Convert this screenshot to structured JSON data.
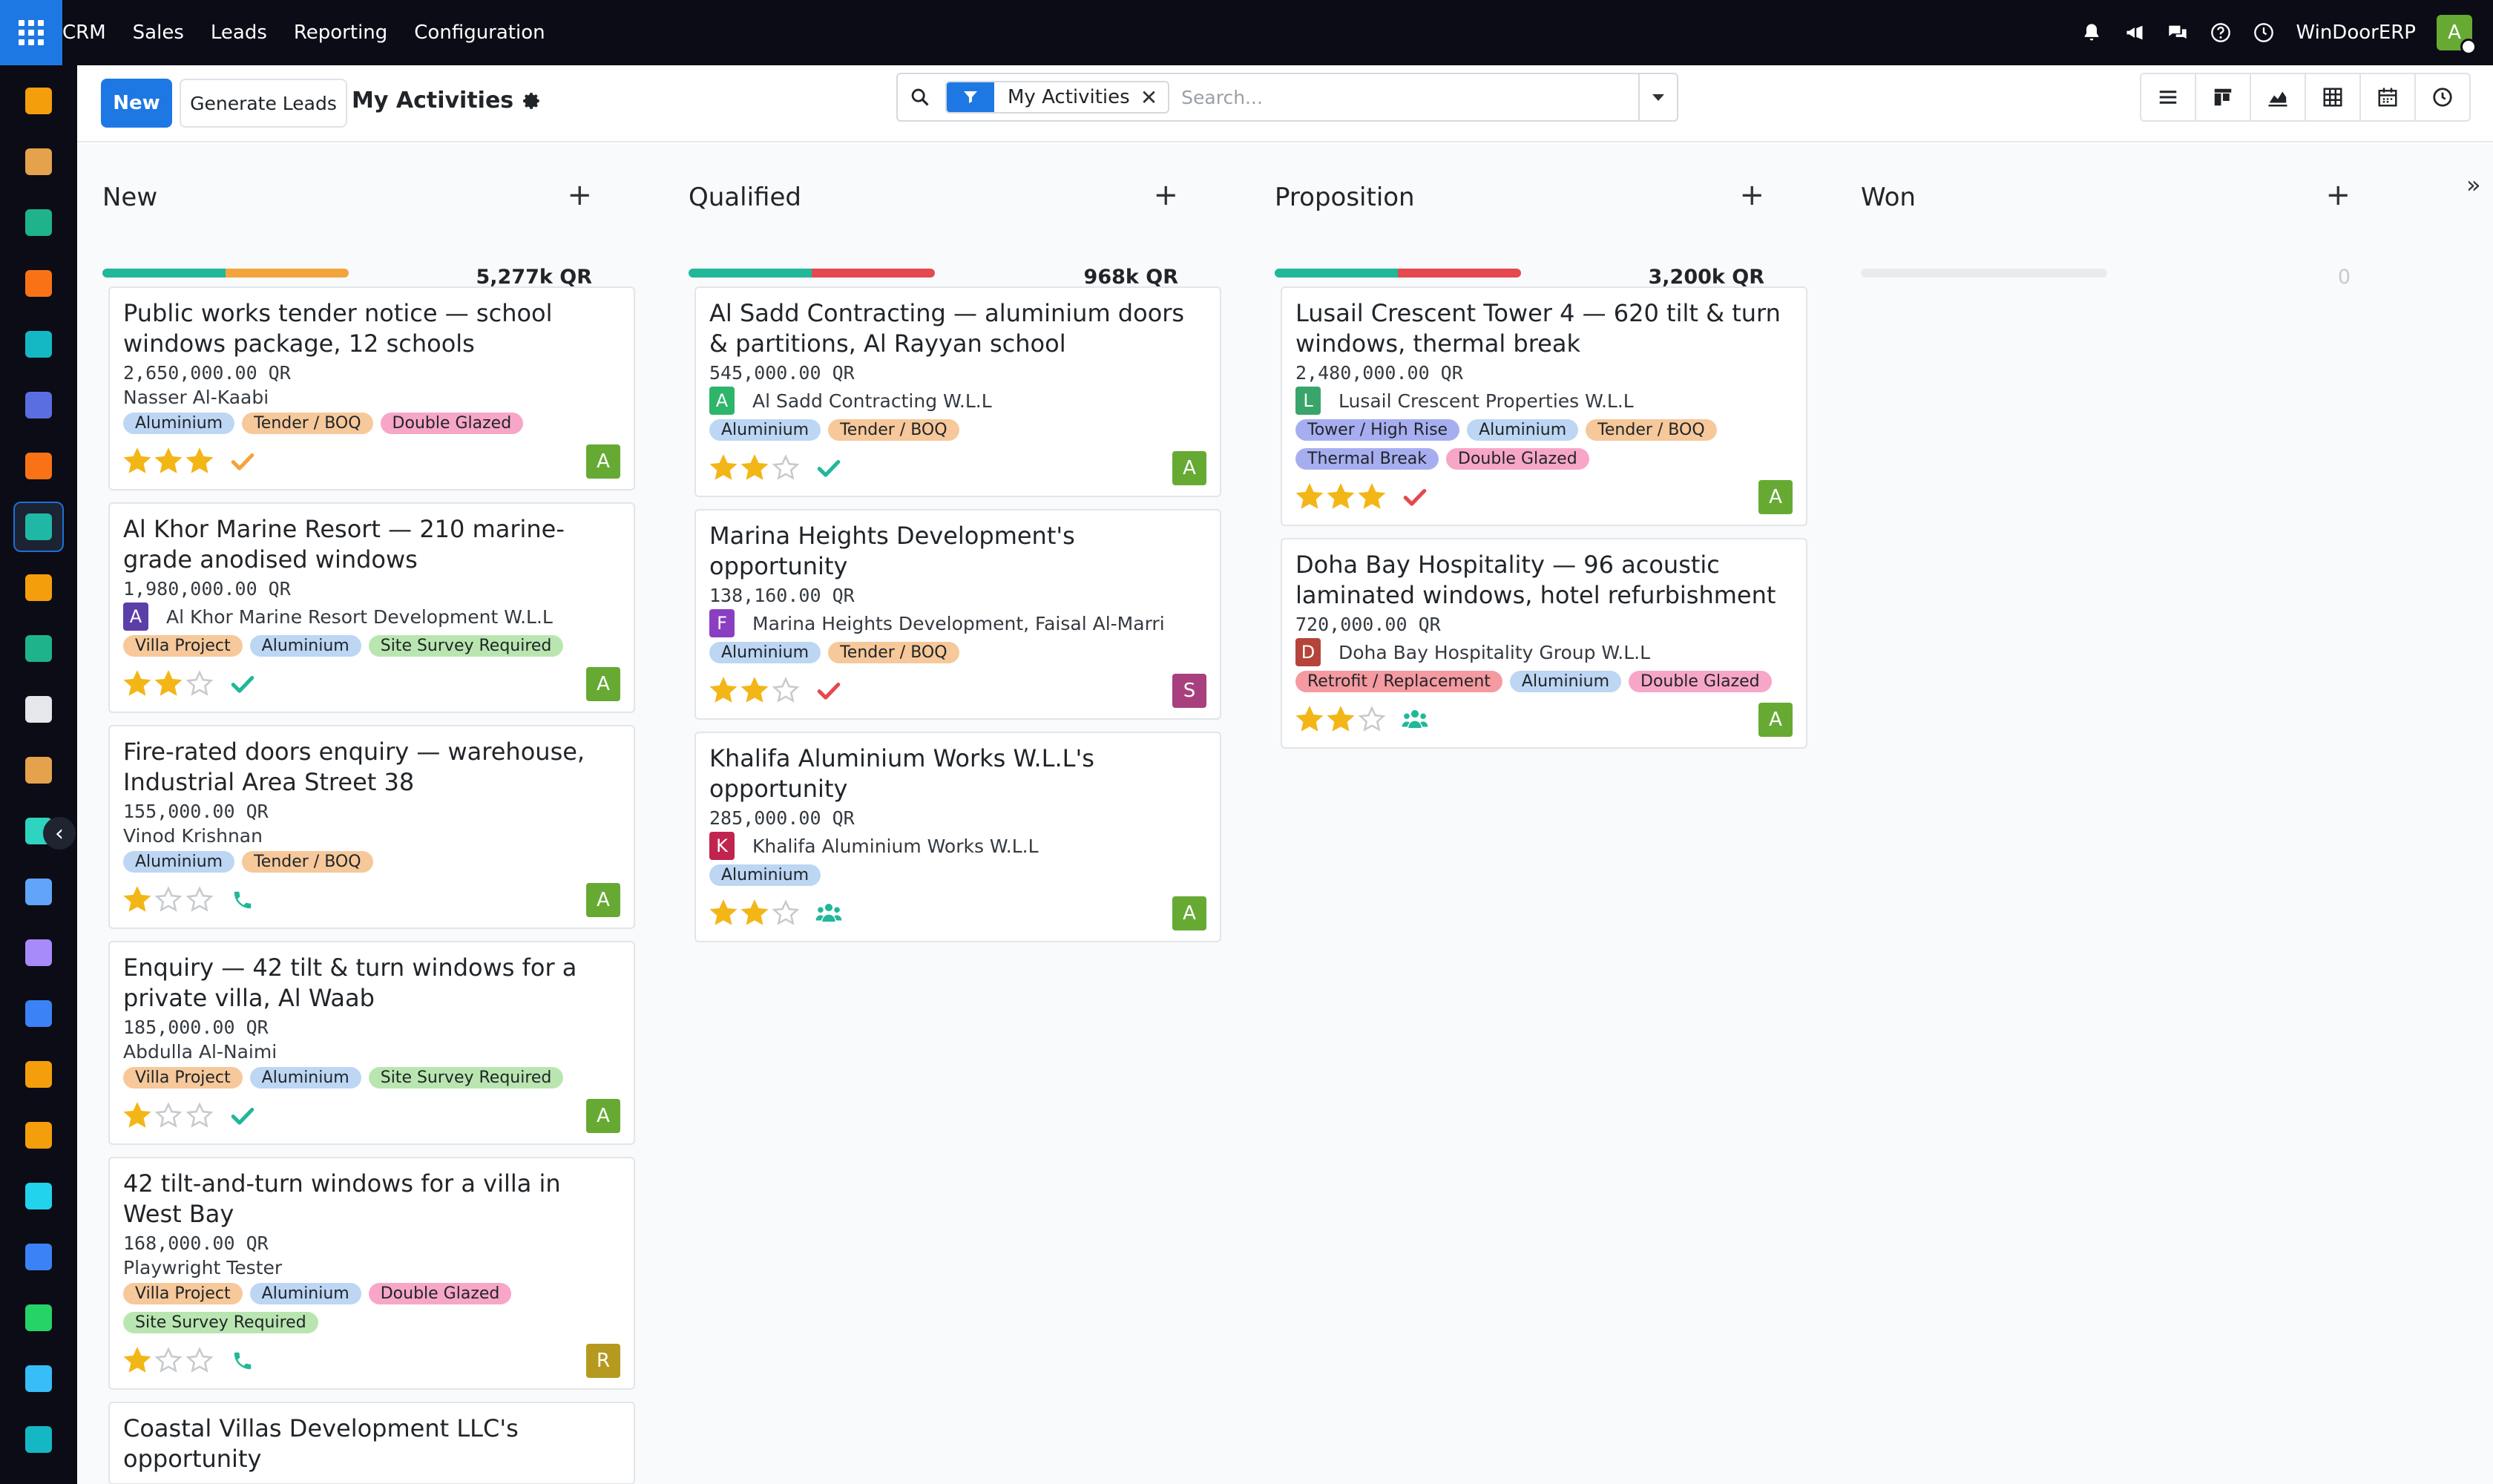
{
  "topbar": {
    "menu": [
      "CRM",
      "Sales",
      "Leads",
      "Reporting",
      "Configuration"
    ],
    "company": "WinDoorERP",
    "user_initial": "A",
    "icons": [
      "bell-icon",
      "megaphone-icon",
      "chat-icon",
      "help-icon",
      "clock-icon"
    ]
  },
  "sidebar": {
    "apps": [
      {
        "name": "dashboards-app-icon",
        "color": "#f59e0b"
      },
      {
        "name": "studio-app-icon",
        "color": "#e5a24c"
      },
      {
        "name": "contacts-app-icon",
        "color": "#1fb38a"
      },
      {
        "name": "discuss-app-icon",
        "color": "#f97316"
      },
      {
        "name": "website-app-icon",
        "color": "#14b8c4"
      },
      {
        "name": "email-marketing-app-icon",
        "color": "#5b6ee1"
      },
      {
        "name": "live-chat-app-icon",
        "color": "#f97316"
      },
      {
        "name": "crm-app-icon",
        "color": "#1fb8a6"
      },
      {
        "name": "sales-app-icon",
        "color": "#f59e0b"
      },
      {
        "name": "employees-app-icon",
        "color": "#1fb38a"
      },
      {
        "name": "inventory-app-icon",
        "color": "#e5e7eb"
      },
      {
        "name": "purchase-app-icon",
        "color": "#e5a24c"
      },
      {
        "name": "project-app-icon",
        "color": "#2dd4bf"
      },
      {
        "name": "knowledge-app-icon",
        "color": "#60a5fa"
      },
      {
        "name": "manufacturing-app-icon",
        "color": "#a78bfa"
      },
      {
        "name": "invoicing-app-icon",
        "color": "#3b82f6"
      },
      {
        "name": "team-app-icon",
        "color": "#f59e0b"
      },
      {
        "name": "calendar-app-icon",
        "color": "#f59e0b"
      },
      {
        "name": "sign-app-icon",
        "color": "#22d3ee"
      },
      {
        "name": "apps-app-icon",
        "color": "#3b82f6"
      },
      {
        "name": "whatsapp-app-icon",
        "color": "#25d366"
      },
      {
        "name": "time-app-icon",
        "color": "#38bdf8"
      },
      {
        "name": "marketing-app-icon",
        "color": "#14b8c4"
      }
    ]
  },
  "control": {
    "new_label": "New",
    "generate_label": "Generate Leads",
    "title": "My Activities",
    "facet": "My Activities",
    "search_placeholder": "Search..."
  },
  "colors": {
    "green": "#21b799",
    "orange": "#f3a43b",
    "red": "#e4494f",
    "star": "#f3b617",
    "star_empty": "#c7cacd",
    "activity_green": "#21b799",
    "activity_orange": "#f3a43b",
    "activity_red": "#e4494f"
  },
  "columns": [
    {
      "title": "New",
      "total": "5,277k QR",
      "progress": [
        {
          "color": "#21b799",
          "pct": 50
        },
        {
          "color": "#f3a43b",
          "pct": 50
        }
      ],
      "cards": [
        {
          "title": "Public works tender notice — school windows package, 12 schools",
          "amount": "2,650,000.00 QR",
          "partner": "Nasser Al-Kaabi",
          "partner_avatar": "",
          "avatar_color": "",
          "tags": [
            "Aluminium",
            "Tender / BOQ",
            "Double Glazed"
          ],
          "stars": 3,
          "activity": "check",
          "activity_color": "#f3a43b",
          "owner": "A",
          "owner_color": "#66aa33"
        },
        {
          "title": "Al Khor Marine Resort — 210 marine-grade anodised windows",
          "amount": "1,980,000.00 QR",
          "partner": "Al Khor Marine Resort Development W.L.L",
          "partner_avatar": "A",
          "avatar_color": "#5b3fa8",
          "tags": [
            "Villa Project",
            "Aluminium",
            "Site Survey Required"
          ],
          "stars": 2,
          "activity": "check",
          "activity_color": "#21b799",
          "owner": "A",
          "owner_color": "#66aa33"
        },
        {
          "title": "Fire-rated doors enquiry — warehouse, Industrial Area Street 38",
          "amount": "155,000.00 QR",
          "partner": "Vinod Krishnan",
          "partner_avatar": "",
          "avatar_color": "",
          "tags": [
            "Aluminium",
            "Tender / BOQ"
          ],
          "stars": 1,
          "activity": "phone",
          "activity_color": "#21b799",
          "owner": "A",
          "owner_color": "#66aa33"
        },
        {
          "title": "Enquiry — 42 tilt & turn windows for a private villa, Al Waab",
          "amount": "185,000.00 QR",
          "partner": "Abdulla Al-Naimi",
          "partner_avatar": "",
          "avatar_color": "",
          "tags": [
            "Villa Project",
            "Aluminium",
            "Site Survey Required"
          ],
          "stars": 1,
          "activity": "check",
          "activity_color": "#21b799",
          "owner": "A",
          "owner_color": "#66aa33"
        },
        {
          "title": "42 tilt-and-turn windows for a villa in West Bay",
          "amount": "168,000.00 QR",
          "partner": "Playwright Tester",
          "partner_avatar": "",
          "avatar_color": "",
          "tags": [
            "Villa Project",
            "Aluminium",
            "Double Glazed",
            "Site Survey Required"
          ],
          "stars": 1,
          "activity": "phone",
          "activity_color": "#21b799",
          "owner": "R",
          "owner_color": "#b59a1f"
        },
        {
          "title": "Coastal Villas Development LLC's opportunity",
          "amount": "",
          "partner": "",
          "partner_avatar": "",
          "avatar_color": "",
          "tags": [],
          "stars": 0,
          "activity": "",
          "activity_color": "",
          "owner": "",
          "owner_color": ""
        }
      ]
    },
    {
      "title": "Qualified",
      "total": "968k QR",
      "progress": [
        {
          "color": "#21b799",
          "pct": 50
        },
        {
          "color": "#e4494f",
          "pct": 50
        }
      ],
      "cards": [
        {
          "title": "Al Sadd Contracting — aluminium doors & partitions, Al Rayyan school",
          "amount": "545,000.00 QR",
          "partner": "Al Sadd Contracting W.L.L",
          "partner_avatar": "A",
          "avatar_color": "#2db56a",
          "tags": [
            "Aluminium",
            "Tender / BOQ"
          ],
          "stars": 2,
          "activity": "check",
          "activity_color": "#21b799",
          "owner": "A",
          "owner_color": "#66aa33"
        },
        {
          "title": "Marina Heights Development's opportunity",
          "amount": "138,160.00 QR",
          "partner": "Marina Heights Development, Faisal Al-Marri",
          "partner_avatar": "F",
          "avatar_color": "#8a3fc2",
          "tags": [
            "Aluminium",
            "Tender / BOQ"
          ],
          "stars": 2,
          "activity": "check",
          "activity_color": "#e4494f",
          "owner": "S",
          "owner_color": "#a8407e"
        },
        {
          "title": "Khalifa Aluminium Works W.L.L's opportunity",
          "amount": "285,000.00 QR",
          "partner": "Khalifa Aluminium Works W.L.L",
          "partner_avatar": "K",
          "avatar_color": "#c0244f",
          "tags": [
            "Aluminium"
          ],
          "stars": 2,
          "activity": "group",
          "activity_color": "#21b799",
          "owner": "A",
          "owner_color": "#66aa33"
        }
      ]
    },
    {
      "title": "Proposition",
      "total": "3,200k QR",
      "progress": [
        {
          "color": "#21b799",
          "pct": 50
        },
        {
          "color": "#e4494f",
          "pct": 50
        }
      ],
      "cards": [
        {
          "title": "Lusail Crescent Tower 4 — 620 tilt & turn windows, thermal break",
          "amount": "2,480,000.00 QR",
          "partner": "Lusail Crescent Properties W.L.L",
          "partner_avatar": "L",
          "avatar_color": "#3aa56b",
          "tags": [
            "Tower / High Rise",
            "Aluminium",
            "Tender / BOQ",
            "Thermal Break",
            "Double Glazed"
          ],
          "stars": 3,
          "activity": "check",
          "activity_color": "#e4494f",
          "owner": "A",
          "owner_color": "#66aa33"
        },
        {
          "title": "Doha Bay Hospitality — 96 acoustic laminated windows, hotel refurbishment",
          "amount": "720,000.00 QR",
          "partner": "Doha Bay Hospitality Group W.L.L",
          "partner_avatar": "D",
          "avatar_color": "#b5443a",
          "tags": [
            "Retrofit / Replacement",
            "Aluminium",
            "Double Glazed"
          ],
          "stars": 2,
          "activity": "group",
          "activity_color": "#21b799",
          "owner": "A",
          "owner_color": "#66aa33"
        }
      ]
    },
    {
      "title": "Won",
      "total": "0",
      "progress": [],
      "cards": []
    }
  ],
  "tag_colors": {
    "Aluminium": "#bcd6f3",
    "Tender / BOQ": "#f6c89a",
    "Double Glazed": "#f7a6c8",
    "Villa Project": "#f6c89a",
    "Site Survey Required": "#b9e6b0",
    "Tower / High Rise": "#a7aef0",
    "Thermal Break": "#a7aef0",
    "Retrofit / Replacement": "#f59aa0"
  }
}
